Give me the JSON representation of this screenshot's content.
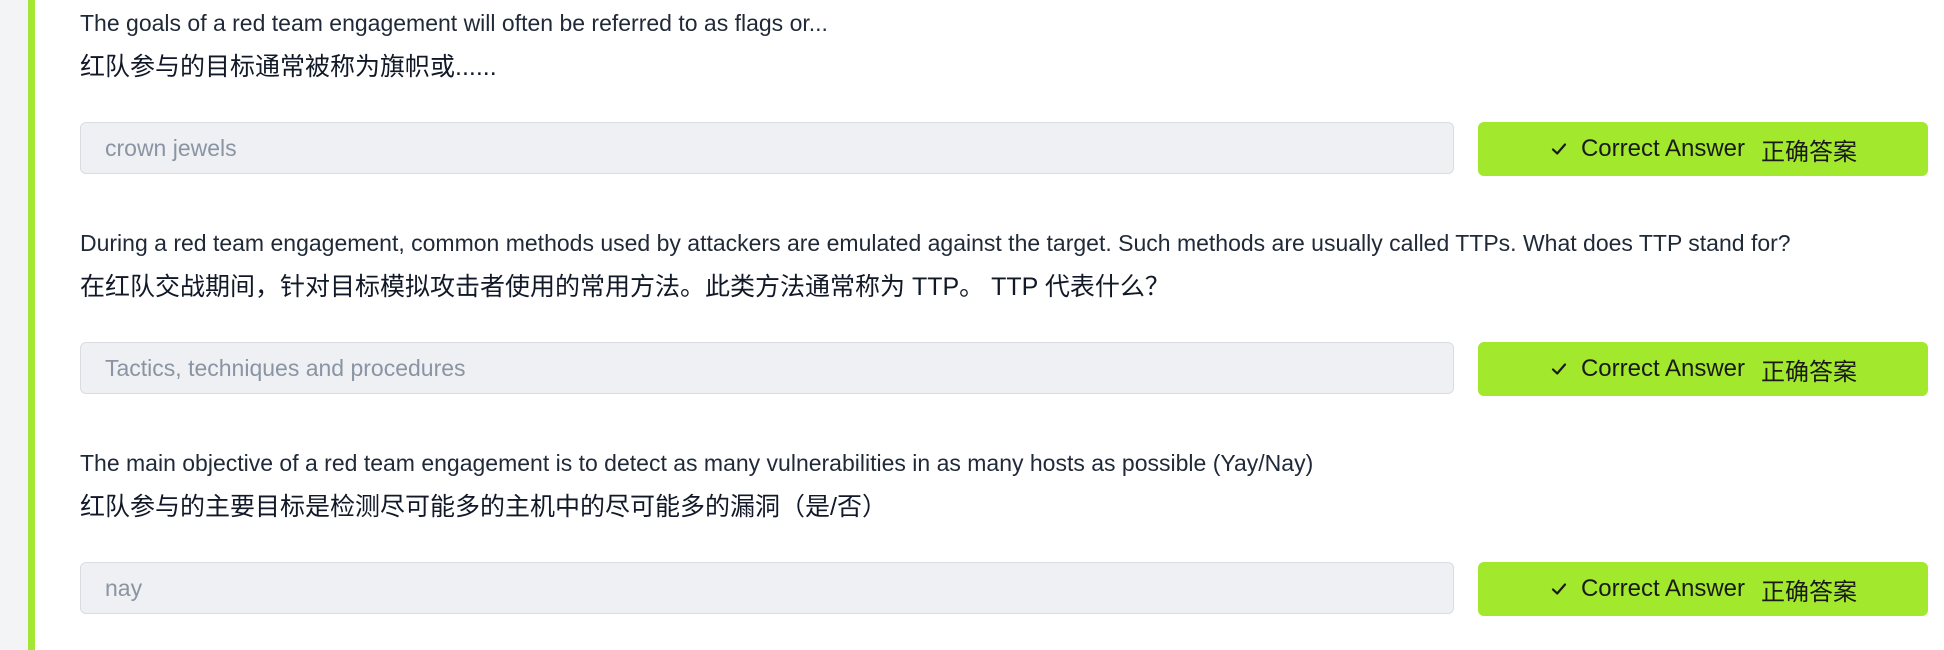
{
  "colors": {
    "accent": "#a3e635",
    "button_bg": "#a2e82c",
    "input_bg": "#eef0f3",
    "input_text": "#8a94a3"
  },
  "questions": [
    {
      "text_en": "The goals of a red team engagement will often be referred to as flags or...",
      "text_zh": "红队参与的目标通常被称为旗帜或......",
      "answer_value": "crown jewels",
      "button_label": "Correct Answer",
      "button_label_zh": "正确答案",
      "button_icon": "check-icon"
    },
    {
      "text_en": "During a red team engagement, common methods used by attackers are emulated against the target. Such methods are usually called TTPs. What does TTP stand for?",
      "text_zh": "在红队交战期间，针对目标模拟攻击者使用的常用方法。此类方法通常称为 TTP。 TTP 代表什么？",
      "answer_value": "Tactics, techniques and procedures",
      "button_label": "Correct Answer",
      "button_label_zh": "正确答案",
      "button_icon": "check-icon"
    },
    {
      "text_en": "The main objective of a red team engagement is to detect as many vulnerabilities in as many hosts as possible (Yay/Nay)",
      "text_zh": "红队参与的主要目标是检测尽可能多的主机中的尽可能多的漏洞（是/否）",
      "answer_value": "nay",
      "button_label": "Correct Answer",
      "button_label_zh": "正确答案",
      "button_icon": "check-icon"
    }
  ]
}
